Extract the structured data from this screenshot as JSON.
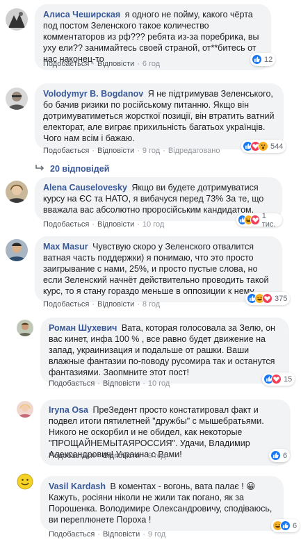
{
  "action_labels": {
    "like": "Подобається",
    "reply": "Відповісти",
    "edited": "Відредаговано"
  },
  "colors": {
    "link": "#385898",
    "bubble": "#f2f3f5",
    "like_blue": "#1877f2",
    "love_red": "#f33e58",
    "haha_yellow": "#f7b125"
  },
  "comments": [
    {
      "author": "Алиса Чеширская",
      "text": "я одного не пойму, какого чёрта под постом Зеленского такое количество комментаторов из рф??? ребята из-за поребрика, вы уху ели?? занимайтесь своей страной, от**битесь от нас наконец-то",
      "time": "6 год",
      "reactions": [
        "like-icon"
      ],
      "reaction_count": "12",
      "avatar": "avatar-bw-photo-icon"
    },
    {
      "author": "Volodymyr B. Bogdanov",
      "text": "Я не підтримував Зеленського, бо бачив ризики по російському питанню. Якщо він дотримуватиметься жорсткої позиції, він втратить ватний електорат, але виграє прихильність багатьох українців. Чого нам всім і бажаю.",
      "time": "9 год",
      "edited": true,
      "reactions": [
        "like-icon",
        "love-icon",
        "wow-icon"
      ],
      "reaction_count": "544",
      "avatar": "avatar-man-photo-icon"
    },
    {
      "author": "Alena Causelovesky",
      "text": "Якщо ви будете дотримуватися курсу на ЄС та НАТО, я вибачуся перед 73% За те, що вважала вас абсолютно проросійським кандидатом.",
      "time": "10 год",
      "reactions": [
        "like-icon",
        "haha-icon",
        "love-icon"
      ],
      "reaction_count": "1 тис.",
      "avatar": "avatar-woman-photo-icon"
    },
    {
      "author": "Max Masur",
      "text": "Чувствую скоро у Зеленского отвалится ватная часть поддержки) я понимаю, что это просто заигрывание с нами, 25%, и просто пустые слова, но если Зеленский начнёт действительно проводить такой курс, то я стану гораздо меньше в оппозиции к нему.",
      "time": "8 год",
      "reactions": [
        "like-icon",
        "haha-icon",
        "love-icon"
      ],
      "reaction_count": "375",
      "avatar": "avatar-man2-photo-icon"
    },
    {
      "author": "Роман Шухевич",
      "text": "Вата, которая голосовала за Зелю, он вас кинет, инфа 100 % , все равно будет движение на запад, украинизация и подальше от рашки. Ваши влажные фантазии по-поводу русомира так и останутся фантазиями. Заопмните этот пост!",
      "time": "10 год",
      "reactions": [
        "like-icon",
        "love-icon"
      ],
      "reaction_count": "15",
      "avatar": "avatar-man3-photo-icon"
    },
    {
      "author": "Iryna Osa",
      "text": "ПреЗедент просто констатировал факт и подвел итоги пятилетней \"дружбы\" с мышебратьями. Никого не оскорбил и не обидел, как некоторые \"ПРОЩАЙНЕМЫТАЯРОССИЯ\". Удачи, Владимир Александрович! Украина с Вами!",
      "time": "9 год",
      "reactions": [
        "like-icon"
      ],
      "reaction_count": "6",
      "avatar": "avatar-woman2-photo-icon"
    },
    {
      "author": "Vasil Kardash",
      "text": "В коментах - вогонь, вата палає ! 😀 Кажуть, росіяни ніколи не жили так погано, як за Порошенка. Володимире Олександровичу, сподіваюсь, ви переплюнете Пороха !",
      "time": "9 год",
      "reactions": [
        "haha-icon",
        "like-icon"
      ],
      "reaction_count": "6",
      "avatar": "avatar-smiley-icon"
    }
  ],
  "replies_link": "20 відповідей"
}
